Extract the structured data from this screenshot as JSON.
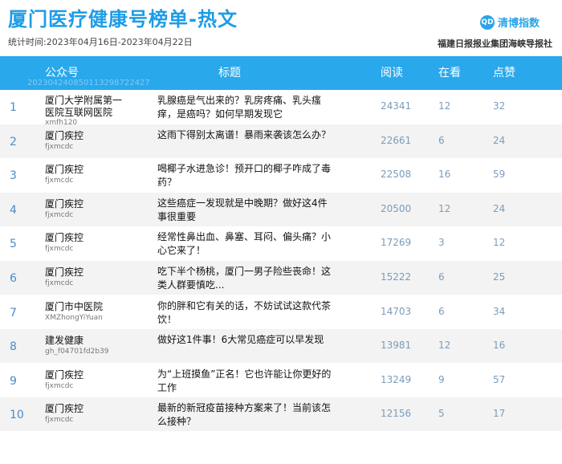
{
  "header": {
    "title": "厦门医疗健康号榜单-热文",
    "period": "统计时间:2023年04月16日-2023年04月22日",
    "brand_icon": "QD",
    "brand_name": "清博指数",
    "source": "福建日报报业集团海峡导报社"
  },
  "table": {
    "columns": {
      "account": "公众号",
      "title": "标题",
      "reads": "阅读",
      "looks": "在看",
      "likes": "点赞"
    },
    "header_code": "20230424085011329872242​7",
    "rows": [
      {
        "rank": "1",
        "account": "厦门大学附属第一医院互联网医院",
        "account_id": "xmfh120",
        "title": "乳腺癌是气出来的？乳房疼痛、乳头瘙痒，是癌吗？如何早期发现它",
        "reads": "24341",
        "looks": "12",
        "likes": "32"
      },
      {
        "rank": "2",
        "account": "厦门疾控",
        "account_id": "fjxmcdc",
        "title": "这雨下得别太离谱！暴雨来袭该怎么办？",
        "reads": "22661",
        "looks": "6",
        "likes": "24"
      },
      {
        "rank": "3",
        "account": "厦门疾控",
        "account_id": "fjxmcdc",
        "title": "喝椰子水进急诊！预开口的椰子咋成了毒药？",
        "reads": "22508",
        "looks": "16",
        "likes": "59"
      },
      {
        "rank": "4",
        "account": "厦门疾控",
        "account_id": "fjxmcdc",
        "title": "这些癌症一发现就是中晚期？做好这4件事很重要",
        "reads": "20500",
        "looks": "12",
        "likes": "24"
      },
      {
        "rank": "5",
        "account": "厦门疾控",
        "account_id": "fjxmcdc",
        "title": "经常性鼻出血、鼻塞、耳闷、偏头痛？小心它来了！",
        "reads": "17269",
        "looks": "3",
        "likes": "12"
      },
      {
        "rank": "6",
        "account": "厦门疾控",
        "account_id": "fjxmcdc",
        "title": "吃下半个杨桃，厦门一男子险些丧命！这类人群要慎吃...",
        "reads": "15222",
        "looks": "6",
        "likes": "25"
      },
      {
        "rank": "7",
        "account": "厦门市中医院",
        "account_id": "XMZhongYiYuan",
        "title": "你的胖和它有关的话，不妨试试这款代茶饮！",
        "reads": "14703",
        "looks": "6",
        "likes": "34"
      },
      {
        "rank": "8",
        "account": "建发健康",
        "account_id": "gh_f04701fd2b39",
        "title": "做好这1件事！6大常见癌症可以早发现",
        "reads": "13981",
        "looks": "12",
        "likes": "16"
      },
      {
        "rank": "9",
        "account": "厦门疾控",
        "account_id": "fjxmcdc",
        "title": "为“上班摸鱼”正名！它也许能让你更好的工作",
        "reads": "13249",
        "looks": "9",
        "likes": "57"
      },
      {
        "rank": "10",
        "account": "厦门疾控",
        "account_id": "fjxmcdc",
        "title": "最新的新冠疫苗接种方案来了！当前该怎么接种？",
        "reads": "12156",
        "looks": "5",
        "likes": "17"
      }
    ]
  }
}
